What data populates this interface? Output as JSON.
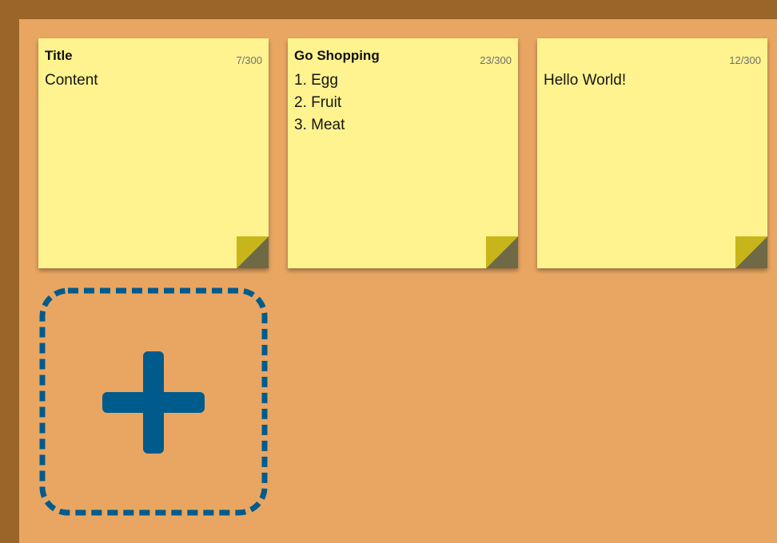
{
  "colors": {
    "frame": "#9a6529",
    "board": "#e8a662",
    "note_bg": "#fff38f",
    "fold_light": "#c8b51a",
    "fold_dark": "#6f6a45",
    "add_border": "#005b8d",
    "count_text": "#6f6f6f"
  },
  "notes": [
    {
      "title": "Title",
      "count": "7/300",
      "content": "Content"
    },
    {
      "title": "Go Shopping",
      "count": "23/300",
      "content": "1. Egg\n2. Fruit\n3. Meat"
    },
    {
      "title": "",
      "count": "12/300",
      "content": "Hello World!"
    }
  ],
  "add_note": {
    "icon": "plus-icon"
  }
}
